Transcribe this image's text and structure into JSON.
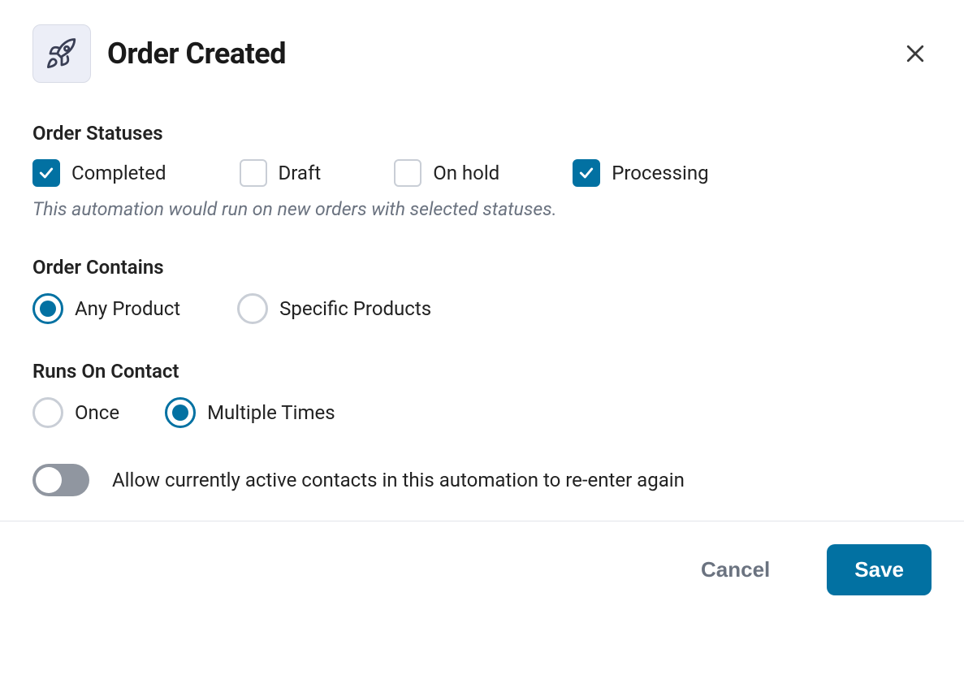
{
  "header": {
    "title": "Order Created"
  },
  "sections": {
    "order_statuses": {
      "label": "Order Statuses",
      "help": "This automation would run on new orders with selected statuses.",
      "options": {
        "completed": {
          "label": "Completed",
          "checked": true
        },
        "draft": {
          "label": "Draft",
          "checked": false
        },
        "on_hold": {
          "label": "On hold",
          "checked": false
        },
        "processing": {
          "label": "Processing",
          "checked": true
        }
      }
    },
    "order_contains": {
      "label": "Order Contains",
      "options": {
        "any": {
          "label": "Any Product",
          "selected": true
        },
        "specific": {
          "label": "Specific Products",
          "selected": false
        }
      }
    },
    "runs_on_contact": {
      "label": "Runs On Contact",
      "options": {
        "once": {
          "label": "Once",
          "selected": false
        },
        "multiple": {
          "label": "Multiple Times",
          "selected": true
        }
      }
    },
    "reenter_toggle": {
      "label": "Allow currently active contacts in this automation to re-enter again",
      "on": false
    }
  },
  "footer": {
    "cancel": "Cancel",
    "save": "Save"
  }
}
